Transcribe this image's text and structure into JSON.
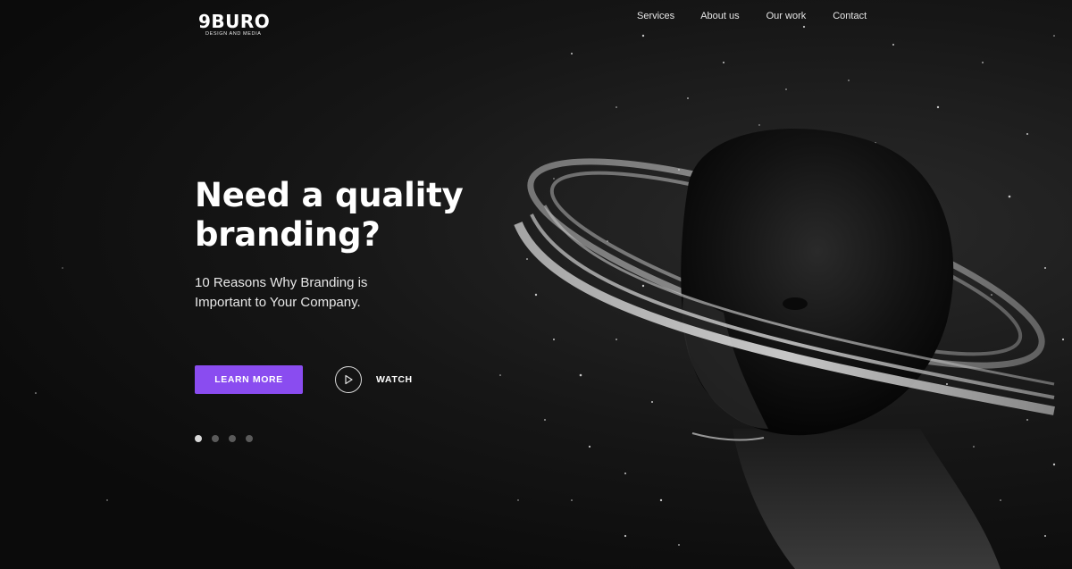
{
  "brand": {
    "logo_text": "9BURO",
    "logo_tagline": "DESIGN AND MEDIA"
  },
  "nav": {
    "items": [
      {
        "label": "Services"
      },
      {
        "label": "About us"
      },
      {
        "label": "Our work"
      },
      {
        "label": "Contact"
      }
    ]
  },
  "hero": {
    "headline_line1": "Need a quality",
    "headline_line2": "branding?",
    "subcopy_line1": "10 Reasons Why Branding is",
    "subcopy_line2": "Important to Your Company.",
    "cta_label": "LEARN MORE",
    "watch_label": "WATCH"
  },
  "slider": {
    "total": 4,
    "active_index": 0
  },
  "colors": {
    "accent": "#8a4cf0",
    "background": "#0c0c0c",
    "text": "#ffffff"
  },
  "icons": {
    "play": "play-icon"
  }
}
